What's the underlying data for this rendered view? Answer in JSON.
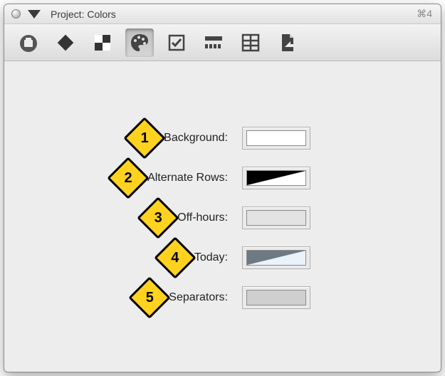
{
  "window": {
    "title": "Project: Colors",
    "shortcut": "⌘4"
  },
  "toolbar": {
    "icons": [
      "briefcase-icon",
      "diamond-icon",
      "checkerboard-icon",
      "palette-icon",
      "checkbox-icon",
      "slider-icon",
      "table-icon",
      "page-arrow-icon"
    ],
    "selected_index": 3
  },
  "options": [
    {
      "marker": "1",
      "label": "Background:",
      "swatch": "white"
    },
    {
      "marker": "2",
      "label": "Alternate Rows:",
      "swatch": "split-bw"
    },
    {
      "marker": "3",
      "label": "Off-hours:",
      "swatch": "light"
    },
    {
      "marker": "4",
      "label": "Today:",
      "swatch": "split-blue"
    },
    {
      "marker": "5",
      "label": "Separators:",
      "swatch": "gray"
    }
  ]
}
